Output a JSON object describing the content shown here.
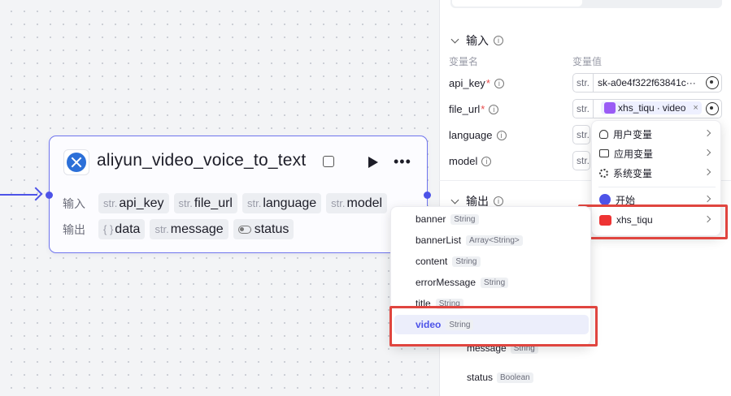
{
  "node": {
    "title": "aliyun_video_voice_to_text",
    "input_label": "输入",
    "output_label": "输出",
    "inputs": [
      {
        "pre": "str.",
        "name": "api_key"
      },
      {
        "pre": "str.",
        "name": "file_url"
      },
      {
        "pre": "str.",
        "name": "language"
      },
      {
        "pre": "str.",
        "name": "model"
      }
    ],
    "outputs": [
      {
        "pre": "{ }",
        "name": "data"
      },
      {
        "pre": "str.",
        "name": "message"
      },
      {
        "pre": "",
        "name": "status"
      }
    ]
  },
  "panel": {
    "input_section": "输入",
    "output_section": "输出",
    "col_name": "变量名",
    "col_value": "变量值",
    "params": [
      {
        "name": "api_key",
        "required": "*",
        "pre": "str.",
        "value": "sk-a0e4f322f63841c···"
      },
      {
        "name": "file_url",
        "required": "*",
        "pre": "str.",
        "value": ""
      },
      {
        "name": "language",
        "required": "",
        "pre": "str.",
        "value": ""
      },
      {
        "name": "model",
        "required": "",
        "pre": "str.",
        "value": ""
      }
    ],
    "file_url_ref": {
      "node": "xhs_tiqu",
      "sep": "·",
      "field": "video",
      "close": "×"
    },
    "output_rows": [
      {
        "name": "message",
        "type": "String"
      },
      {
        "name": "status",
        "type": "Boolean"
      }
    ]
  },
  "var_menu": {
    "items": [
      {
        "label": "用户变量",
        "icon": "user-icon"
      },
      {
        "label": "应用变量",
        "icon": "folder-icon"
      },
      {
        "label": "系统变量",
        "icon": "gear-icon"
      },
      {
        "label": "开始",
        "icon": "start-node-icon"
      },
      {
        "label": "xhs_tiqu",
        "icon": "xhs-node-icon"
      }
    ]
  },
  "field_menu": {
    "items": [
      {
        "name": "banner",
        "type": "String"
      },
      {
        "name": "bannerList",
        "type": "Array<String>"
      },
      {
        "name": "content",
        "type": "String"
      },
      {
        "name": "errorMessage",
        "type": "String"
      },
      {
        "name": "title",
        "type": "String"
      },
      {
        "name": "video",
        "type": "String"
      }
    ]
  },
  "colors": {
    "accent": "#4d53e8",
    "highlight": "#e0453f"
  }
}
